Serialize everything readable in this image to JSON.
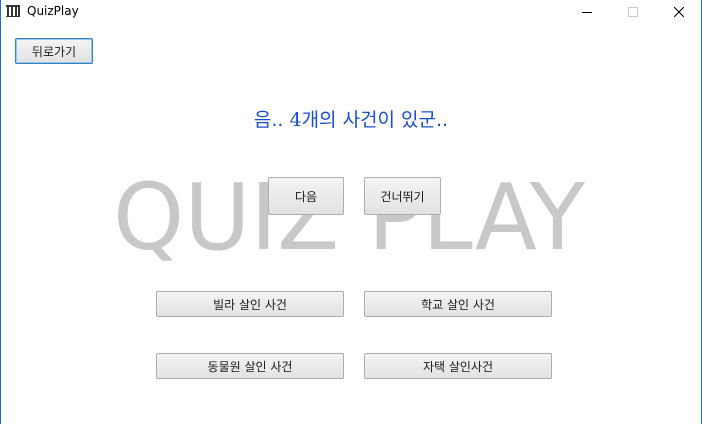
{
  "window": {
    "title": "QuizPlay"
  },
  "icons": {
    "app": "app-icon",
    "minimize": "minimize-icon",
    "maximize": "maximize-icon",
    "close": "close-icon"
  },
  "toolbar": {
    "back_label": "뒤로가기"
  },
  "headline": {
    "prefix": "음.. ",
    "count": "4",
    "suffix": "개의 사건이 있군.."
  },
  "watermark": {
    "text": "QUIZ PLAY"
  },
  "actions": {
    "next_label": "다음",
    "skip_label": "건너뛰기"
  },
  "cases": [
    {
      "label": "빌라 살인 사건"
    },
    {
      "label": "학교 살인 사건"
    },
    {
      "label": "동물원 살인 사건"
    },
    {
      "label": "자택 살인사건"
    }
  ],
  "colors": {
    "headline": "#1b4fc8",
    "watermark": "#c8c8c8",
    "accent_border": "#1f6fc5"
  }
}
